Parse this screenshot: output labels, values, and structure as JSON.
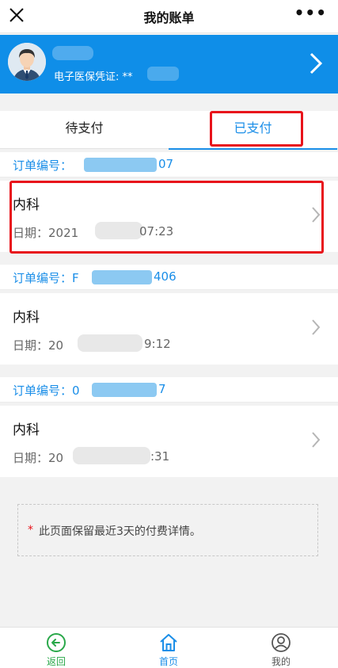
{
  "topbar": {
    "title": "我的账单",
    "more": "•••"
  },
  "user": {
    "credential_label": "电子医保凭证: **"
  },
  "tabs": [
    {
      "label": "待支付",
      "active": false
    },
    {
      "label": "已支付",
      "active": true
    }
  ],
  "orders": [
    {
      "order_label": "订单编号：",
      "order_suffix": "07",
      "department": "内科",
      "date_label": "日期：2021",
      "time_suffix": "07:23"
    },
    {
      "order_label": "订单编号：F",
      "order_suffix": "406",
      "department": "内科",
      "date_label": "日期：20",
      "time_suffix": "9:12"
    },
    {
      "order_label": "订单编号：0",
      "order_suffix": "7",
      "department": "内科",
      "date_label": "日期：20",
      "time_suffix": ":31"
    }
  ],
  "notice": {
    "star": "*",
    "text": "此页面保留最近3天的付费详情。"
  },
  "bottom_nav": [
    {
      "label": "返回",
      "icon": "back-icon",
      "color": "#2aa84a"
    },
    {
      "label": "首页",
      "icon": "home-icon",
      "color": "#1a8ee8"
    },
    {
      "label": "我的",
      "icon": "profile-icon",
      "color": "#555555"
    }
  ],
  "colors": {
    "brand_blue": "#0f8ee8",
    "highlight_red": "#e8131b",
    "back_green": "#2aa84a"
  }
}
